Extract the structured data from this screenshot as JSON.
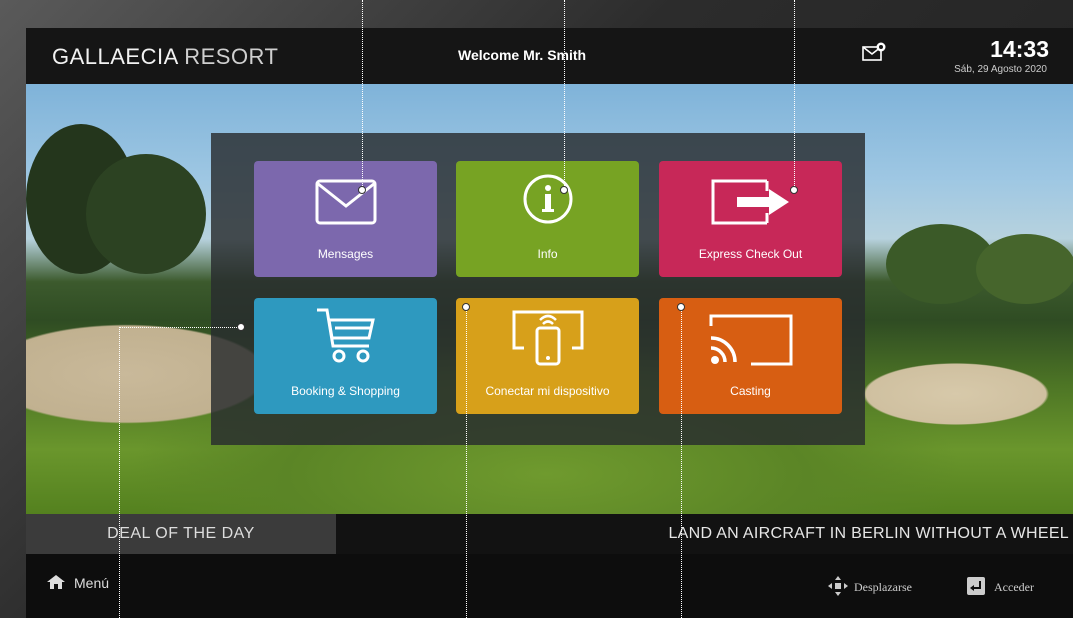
{
  "header": {
    "brand_main": "GALLAECIA",
    "brand_sub": "RESORT",
    "welcome": "Welcome Mr. Smith",
    "time": "14:33",
    "date": "Sáb, 29 Agosto 2020"
  },
  "tiles": [
    {
      "label": "Mensages",
      "color": "#7c68ad",
      "icon": "envelope-icon"
    },
    {
      "label": "Info",
      "color": "#77a323",
      "icon": "info-icon"
    },
    {
      "label": "Express Check Out",
      "color": "#c72858",
      "icon": "exit-icon"
    },
    {
      "label": "Booking & Shopping",
      "color": "#2e99bf",
      "icon": "cart-icon"
    },
    {
      "label": "Conectar mi dispositivo",
      "color": "#d7a01a",
      "icon": "phone-wifi-icon"
    },
    {
      "label": "Casting",
      "color": "#d75e12",
      "icon": "cast-icon"
    }
  ],
  "ticker": {
    "deal_label": "DEAL OF THE DAY",
    "text": "LAND AN AIRCRAFT IN BERLIN WITHOUT A WHEEL"
  },
  "footer": {
    "menu": "Menú",
    "move": "Desplazarse",
    "enter": "Acceder"
  }
}
